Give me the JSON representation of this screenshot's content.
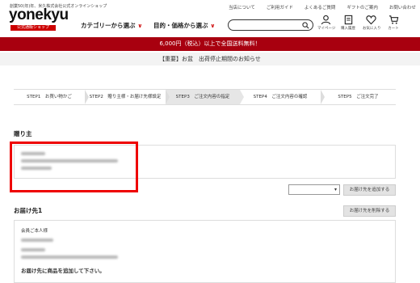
{
  "header": {
    "tagline": "創業50(年)年、米久株式会社公式オンラインショップ",
    "logo": "yonekyu",
    "logo_badge": "公式通販ショップ",
    "nav": [
      "カテゴリーから選ぶ",
      "目的・価格から選ぶ"
    ],
    "top_links": [
      "当店について",
      "ご利用ガイド",
      "よくあるご質問",
      "ギフトのご案内",
      "お問い合わせ"
    ],
    "search_placeholder": "",
    "icons": [
      {
        "name": "mypage-icon",
        "label": "マイページ"
      },
      {
        "name": "history-icon",
        "label": "購入履歴"
      },
      {
        "name": "favorite-icon",
        "label": "お気に入り"
      },
      {
        "name": "cart-icon",
        "label": "カート"
      }
    ]
  },
  "banner": "6,000円（税込）以上で全国送料無料！",
  "notice": "【重要】お盆　出荷停止期間のお知らせ",
  "steps": [
    "STEP1　お買い物かご",
    "STEP2　贈り主様・お届け先様設定",
    "STEP3　ご注文内容の指定",
    "STEP4　ご注文内容の確認",
    "STEP5　ご注文完了"
  ],
  "sender": {
    "title": "贈り主",
    "add_button": "お届け先を追加する"
  },
  "delivery": {
    "title": "お届け先1",
    "delete_button": "お届け先を削除する",
    "recipient": "会員ご本人様",
    "empty_message": "お届け先に商品を追加して下さい。"
  }
}
